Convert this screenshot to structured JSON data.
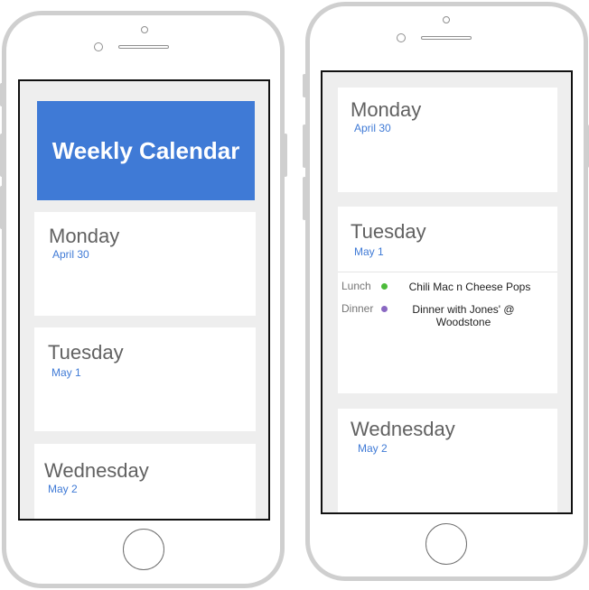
{
  "left_phone": {
    "header": {
      "title": "Weekly Calendar",
      "color": "#3f7ad6"
    },
    "days": [
      {
        "name": "Monday",
        "date": "April 30"
      },
      {
        "name": "Tuesday",
        "date": "May 1"
      },
      {
        "name": "Wednesday",
        "date": "May 2"
      }
    ]
  },
  "right_phone": {
    "days": [
      {
        "name": "Monday",
        "date": "April 30"
      },
      {
        "name": "Tuesday",
        "date": "May 1",
        "events": [
          {
            "label": "Lunch",
            "title": "Chili Mac n Cheese Pops",
            "dot_color": "#4cbb3a"
          },
          {
            "label": "Dinner",
            "title": "Dinner with Jones' @ Woodstone",
            "dot_color": "#8a68c2"
          }
        ]
      },
      {
        "name": "Wednesday",
        "date": "May 2"
      }
    ]
  }
}
